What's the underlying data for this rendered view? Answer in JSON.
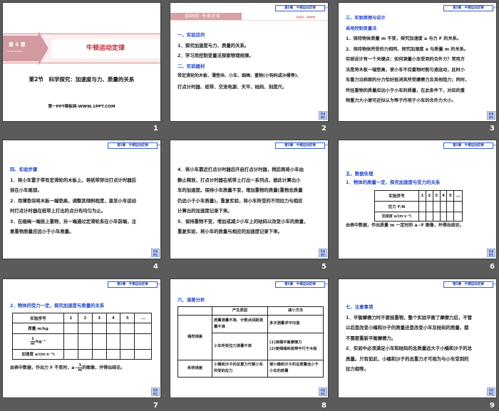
{
  "header_tab": "第5章　牛顿运动定律",
  "nav_button": "栏目导引",
  "slides": [
    {
      "number": "1",
      "chapter_badge": "第 5 章",
      "chapter_pinyin": "DI WU ZHANG",
      "chapter_title": "牛顿运动定律",
      "section_title": "第2节　科学探究：加速度与力、质量的关系",
      "footer": "第一PPT模板网-WWW.1PPT.COM"
    },
    {
      "number": "2",
      "banner": "基础梳理 · 明 确 原 理",
      "banner_right": "实验探究 · 突破重难",
      "lines": [
        "一、实验目的",
        "1．探究加速度与力、质量的关系。",
        "2．学习用控制变量法探索物理规律。",
        "二、实验器材",
        "带定滑轮的木板、薄垫块、小车、细绳、重物(小钩码或沙桶等)、",
        "打点计时器、纸带、交流电源、天平、砝码、刻度尺。"
      ]
    },
    {
      "number": "3",
      "lines": [
        "三、实验原理与设计",
        "采用控制变量法",
        "1．保持物体质量 m 不变，探究加速度 a 与力 F 的关系。",
        "2．保持物体所受的力相同，探究加速度 a 与质量 m 的关系。",
        "实验设计有一个关键点：如何测量小车受到的合外力？常用方",
        "法是将木板一端垫高，使小车不拉重物时能匀速运动，此时小",
        "车重力沿斜面的分力恰好抵消其所受摩擦力及其他阻力；同时，",
        "所挂重物的质量应远小于小车的质量，在此条件下，对应的重",
        "物重力大小便可近似认为等于作用于小车的合外力大小。"
      ]
    },
    {
      "number": "4",
      "lines": [
        "四、实验步骤",
        "1．将小车置于带有定滑轮的木板上，将纸带穿过打点计时器后",
        "挂在小车尾部。",
        "2．用薄垫块将木板一端垫高，调整其倾斜程度，直至小车运动",
        "时打点计时器在纸带上打出的点分布均匀为止。",
        "3．在细绳一端挂上重物，另一端通过定滑轮系在小车前端，注",
        "意重物质量应远小于小车质量。"
      ]
    },
    {
      "number": "5",
      "lines": [
        "4．将小车靠近打点计时器后开启打点计时器，稍后再将小车由",
        "静止释放，打点计时器在纸带上打出一系列点，据此计算出小",
        "车的加速度。保持小车质量不变，增加重物的质量(重物总质量",
        "仍远小于小车质量)，重复实验，将小车所受的不同拉力与相应",
        "计算出的加速度记录下来。",
        "5．保持重物不变，增加或减少小车上的砝码以改变小车的质量，",
        "重复实验，将小车的质量与相应的加速度记录下来。"
      ]
    },
    {
      "number": "6",
      "heading": "五、数据处理",
      "subheading": "1．物体的质量一定，探究加速度与受力的关系",
      "table": [
        [
          "实验序号",
          "1",
          "2",
          "3",
          "4",
          "5",
          "…"
        ],
        [
          "拉力 F/N",
          "",
          "",
          "",
          "",
          "",
          ""
        ],
        [
          "加速度 a/(m·s⁻²)",
          "",
          "",
          "",
          "",
          "",
          ""
        ]
      ],
      "footer": "由表中数据，作出质量 m 一定时的 a−F 图像，并得出结论。"
    },
    {
      "number": "7",
      "heading": "2．物体的受力一定，探究加速度与质量的关系",
      "table": [
        [
          "实验序号",
          "1",
          "2",
          "3",
          "4",
          "5",
          "…"
        ],
        [
          "质量 m/kg",
          "",
          "",
          "",
          "",
          "",
          ""
        ],
        [
          "/kg⁻¹",
          "",
          "",
          "",
          "",
          "",
          ""
        ],
        [
          "加速度 a/(m·s⁻²)",
          "",
          "",
          "",
          "",
          "",
          ""
        ]
      ],
      "frac_num": "1",
      "frac_den": "m",
      "footer_before": "由表中数据，作出力 F 不变时，a−",
      "footer_after": "的图像，并得出结论。"
    },
    {
      "number": "8",
      "heading": "六、误差分析",
      "table_head": [
        "",
        "产生原因",
        "减小方法"
      ],
      "rows": [
        {
          "type": "偶然误差",
          "cause1": "质量测量不准、计数点间距测量不准",
          "fix1": "多次测量求平均值",
          "cause2": "小车所受拉力测量不准",
          "fix2": "(1)准确平衡摩擦力\n(2)使细绳和纸带平行于木板"
        },
        {
          "type": "系统误差",
          "cause": "小桶和沙子的总重力代替小车所受的拉力",
          "fix": "使小桶和沙子的总质量远小于小车的质量"
        }
      ]
    },
    {
      "number": "9",
      "lines": [
        "七、注意事项",
        "1．平衡摩擦力时不要挂重物，整个实验平衡了摩擦力后，不管",
        "以后是改变小桶和沙子的质量还是改变小车及砝码的质量，都",
        "不需要重新平衡摩擦力。",
        "2．实验中必须满足小车和砝码的总质量远大于小桶和沙子的总",
        "质量。只有如此，小桶和沙子的总重力才可视为与小车受到的",
        "拉力相等。"
      ]
    }
  ],
  "colors": {
    "background": "#5b5b5b",
    "heading_blue": "#2346c8",
    "title_red": "#c0303a",
    "banner_pink": "#d9a0a5"
  }
}
